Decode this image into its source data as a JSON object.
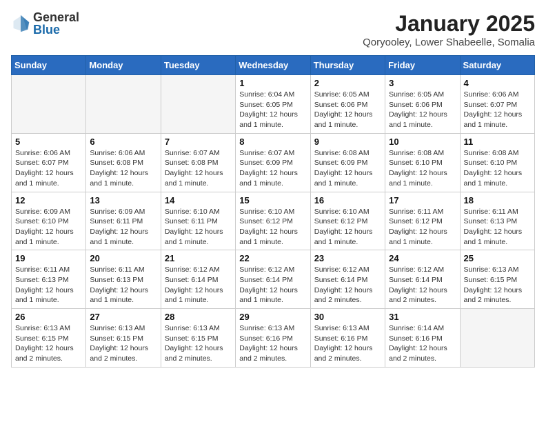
{
  "header": {
    "logo_general": "General",
    "logo_blue": "Blue",
    "month": "January 2025",
    "location": "Qoryooley, Lower Shabeelle, Somalia"
  },
  "weekdays": [
    "Sunday",
    "Monday",
    "Tuesday",
    "Wednesday",
    "Thursday",
    "Friday",
    "Saturday"
  ],
  "weeks": [
    [
      {
        "day": "",
        "info": ""
      },
      {
        "day": "",
        "info": ""
      },
      {
        "day": "",
        "info": ""
      },
      {
        "day": "1",
        "info": "Sunrise: 6:04 AM\nSunset: 6:05 PM\nDaylight: 12 hours\nand 1 minute."
      },
      {
        "day": "2",
        "info": "Sunrise: 6:05 AM\nSunset: 6:06 PM\nDaylight: 12 hours\nand 1 minute."
      },
      {
        "day": "3",
        "info": "Sunrise: 6:05 AM\nSunset: 6:06 PM\nDaylight: 12 hours\nand 1 minute."
      },
      {
        "day": "4",
        "info": "Sunrise: 6:06 AM\nSunset: 6:07 PM\nDaylight: 12 hours\nand 1 minute."
      }
    ],
    [
      {
        "day": "5",
        "info": "Sunrise: 6:06 AM\nSunset: 6:07 PM\nDaylight: 12 hours\nand 1 minute."
      },
      {
        "day": "6",
        "info": "Sunrise: 6:06 AM\nSunset: 6:08 PM\nDaylight: 12 hours\nand 1 minute."
      },
      {
        "day": "7",
        "info": "Sunrise: 6:07 AM\nSunset: 6:08 PM\nDaylight: 12 hours\nand 1 minute."
      },
      {
        "day": "8",
        "info": "Sunrise: 6:07 AM\nSunset: 6:09 PM\nDaylight: 12 hours\nand 1 minute."
      },
      {
        "day": "9",
        "info": "Sunrise: 6:08 AM\nSunset: 6:09 PM\nDaylight: 12 hours\nand 1 minute."
      },
      {
        "day": "10",
        "info": "Sunrise: 6:08 AM\nSunset: 6:10 PM\nDaylight: 12 hours\nand 1 minute."
      },
      {
        "day": "11",
        "info": "Sunrise: 6:08 AM\nSunset: 6:10 PM\nDaylight: 12 hours\nand 1 minute."
      }
    ],
    [
      {
        "day": "12",
        "info": "Sunrise: 6:09 AM\nSunset: 6:10 PM\nDaylight: 12 hours\nand 1 minute."
      },
      {
        "day": "13",
        "info": "Sunrise: 6:09 AM\nSunset: 6:11 PM\nDaylight: 12 hours\nand 1 minute."
      },
      {
        "day": "14",
        "info": "Sunrise: 6:10 AM\nSunset: 6:11 PM\nDaylight: 12 hours\nand 1 minute."
      },
      {
        "day": "15",
        "info": "Sunrise: 6:10 AM\nSunset: 6:12 PM\nDaylight: 12 hours\nand 1 minute."
      },
      {
        "day": "16",
        "info": "Sunrise: 6:10 AM\nSunset: 6:12 PM\nDaylight: 12 hours\nand 1 minute."
      },
      {
        "day": "17",
        "info": "Sunrise: 6:11 AM\nSunset: 6:12 PM\nDaylight: 12 hours\nand 1 minute."
      },
      {
        "day": "18",
        "info": "Sunrise: 6:11 AM\nSunset: 6:13 PM\nDaylight: 12 hours\nand 1 minute."
      }
    ],
    [
      {
        "day": "19",
        "info": "Sunrise: 6:11 AM\nSunset: 6:13 PM\nDaylight: 12 hours\nand 1 minute."
      },
      {
        "day": "20",
        "info": "Sunrise: 6:11 AM\nSunset: 6:13 PM\nDaylight: 12 hours\nand 1 minute."
      },
      {
        "day": "21",
        "info": "Sunrise: 6:12 AM\nSunset: 6:14 PM\nDaylight: 12 hours\nand 1 minute."
      },
      {
        "day": "22",
        "info": "Sunrise: 6:12 AM\nSunset: 6:14 PM\nDaylight: 12 hours\nand 1 minute."
      },
      {
        "day": "23",
        "info": "Sunrise: 6:12 AM\nSunset: 6:14 PM\nDaylight: 12 hours\nand 2 minutes."
      },
      {
        "day": "24",
        "info": "Sunrise: 6:12 AM\nSunset: 6:14 PM\nDaylight: 12 hours\nand 2 minutes."
      },
      {
        "day": "25",
        "info": "Sunrise: 6:13 AM\nSunset: 6:15 PM\nDaylight: 12 hours\nand 2 minutes."
      }
    ],
    [
      {
        "day": "26",
        "info": "Sunrise: 6:13 AM\nSunset: 6:15 PM\nDaylight: 12 hours\nand 2 minutes."
      },
      {
        "day": "27",
        "info": "Sunrise: 6:13 AM\nSunset: 6:15 PM\nDaylight: 12 hours\nand 2 minutes."
      },
      {
        "day": "28",
        "info": "Sunrise: 6:13 AM\nSunset: 6:15 PM\nDaylight: 12 hours\nand 2 minutes."
      },
      {
        "day": "29",
        "info": "Sunrise: 6:13 AM\nSunset: 6:16 PM\nDaylight: 12 hours\nand 2 minutes."
      },
      {
        "day": "30",
        "info": "Sunrise: 6:13 AM\nSunset: 6:16 PM\nDaylight: 12 hours\nand 2 minutes."
      },
      {
        "day": "31",
        "info": "Sunrise: 6:14 AM\nSunset: 6:16 PM\nDaylight: 12 hours\nand 2 minutes."
      },
      {
        "day": "",
        "info": ""
      }
    ]
  ]
}
